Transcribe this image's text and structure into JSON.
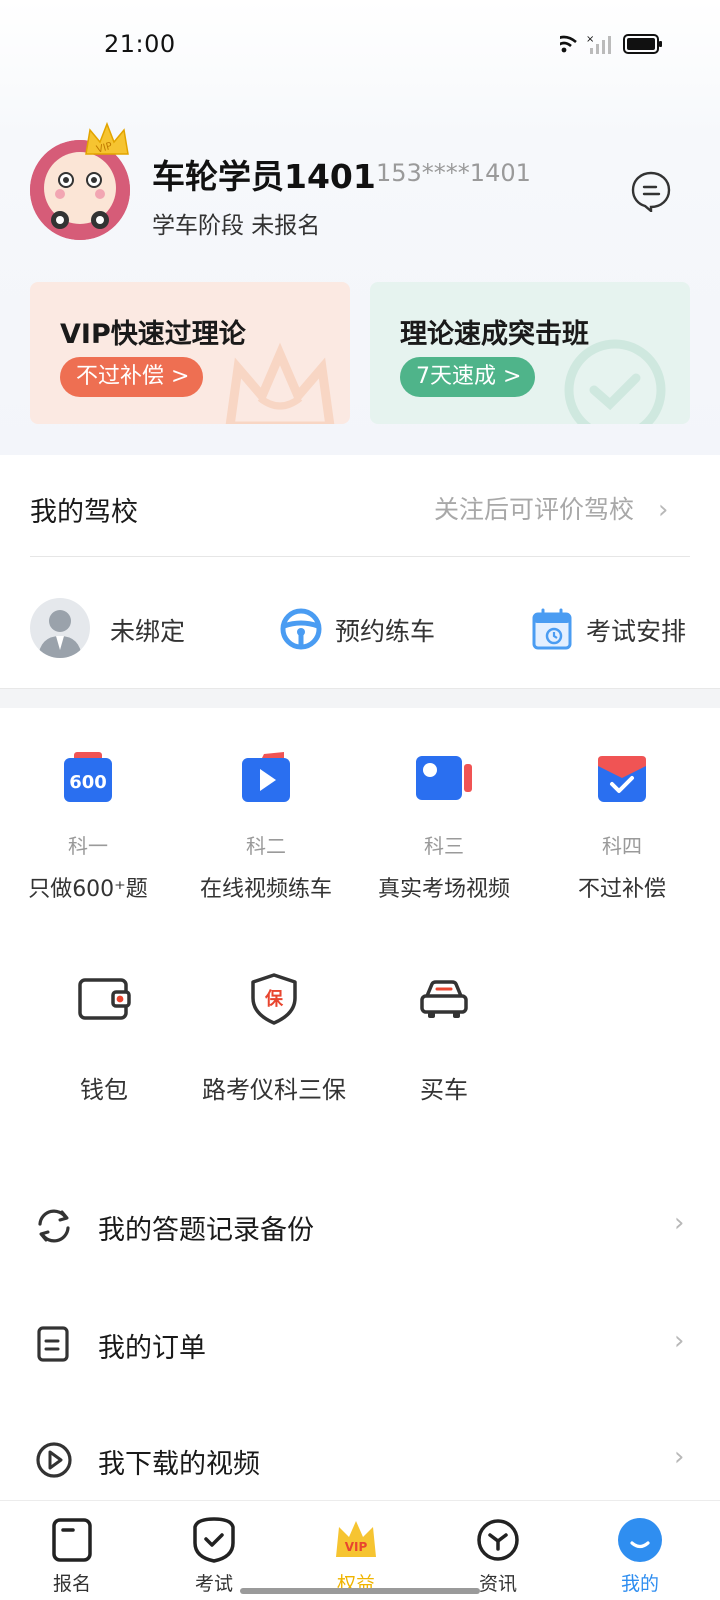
{
  "status_bar": {
    "time": "21:00"
  },
  "profile": {
    "username": "车轮学员1401",
    "phone": "153****1401",
    "stage": "学车阶段 未报名",
    "vip_badge": "VIP"
  },
  "promo_cards": [
    {
      "title": "VIP快速过理论",
      "pill": "不过补偿 >",
      "color": "#ee6f52"
    },
    {
      "title": "理论速成突击班",
      "pill": "7天速成 >",
      "color": "#4fb48a"
    }
  ],
  "school": {
    "title": "我的驾校",
    "hint": "关注后可评价驾校",
    "bind_items": [
      {
        "label": "未绑定",
        "icon": "coach-avatar-icon"
      },
      {
        "label": "预约练车",
        "icon": "steering-wheel-icon"
      },
      {
        "label": "考试安排",
        "icon": "calendar-icon"
      }
    ]
  },
  "subjects": [
    {
      "top": "科一",
      "bottom": "只做600⁺题",
      "icon": "600-questions-icon"
    },
    {
      "top": "科二",
      "bottom": "在线视频练车",
      "icon": "video-play-icon"
    },
    {
      "top": "科三",
      "bottom": "真实考场视频",
      "icon": "video-camera-icon"
    },
    {
      "top": "科四",
      "bottom": "不过补偿",
      "icon": "envelope-check-icon"
    }
  ],
  "tools": [
    {
      "label": "钱包",
      "icon": "wallet-icon"
    },
    {
      "label": "路考仪科三保",
      "icon": "insurance-shield-icon",
      "badge": "保"
    },
    {
      "label": "买车",
      "icon": "car-icon"
    }
  ],
  "list_rows": [
    {
      "label": "我的答题记录备份",
      "icon": "sync-icon"
    },
    {
      "label": "我的订单",
      "icon": "order-icon"
    },
    {
      "label": "我下载的视频",
      "icon": "play-circle-icon"
    }
  ],
  "bottom_nav": [
    {
      "label": "报名",
      "icon": "signup-icon",
      "active": false
    },
    {
      "label": "考试",
      "icon": "exam-shield-icon",
      "active": false
    },
    {
      "label": "权益",
      "icon": "vip-crown-icon",
      "active": false,
      "color": "#f0b400"
    },
    {
      "label": "资讯",
      "icon": "news-icon",
      "active": false
    },
    {
      "label": "我的",
      "icon": "me-icon",
      "active": true,
      "color": "#2f8ef0"
    }
  ],
  "colors": {
    "accent_blue": "#2f8ef0",
    "subject_blue": "#2a6ff0",
    "subject_red": "#f05454",
    "vip_gold": "#f0b400"
  }
}
